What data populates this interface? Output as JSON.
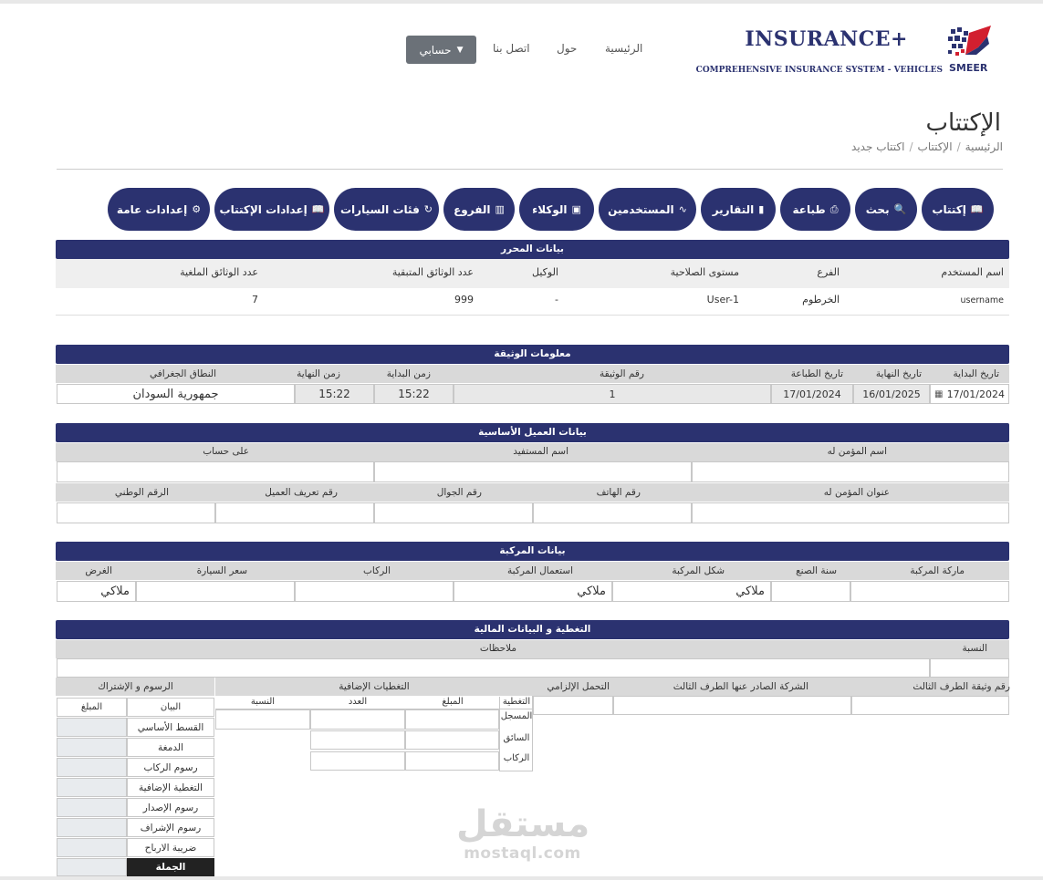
{
  "header": {
    "brand_title": "INSURANCE+",
    "brand_subtitle": "COMPREHENSIVE INSURANCE SYSTEM - VEHICLES",
    "logo_text": "SMEER",
    "nav": [
      "الرئيسية",
      "حول",
      "اتصل بنا"
    ],
    "account_label": "حسابي"
  },
  "page": {
    "title": "الإكتتاب",
    "breadcrumb": [
      "الرئيسية",
      "الإكتتاب",
      "اكتتاب جديد"
    ]
  },
  "toolbar": [
    {
      "label": "إكتتاب",
      "icon": "book-icon"
    },
    {
      "label": "بحث",
      "icon": "search-icon"
    },
    {
      "label": "طباعة",
      "icon": "print-icon"
    },
    {
      "label": "التقارير",
      "icon": "bar-chart-icon"
    },
    {
      "label": "المستخدمين",
      "icon": "pulse-icon"
    },
    {
      "label": "الوكلاء",
      "icon": "id-card-icon"
    },
    {
      "label": "الفروع",
      "icon": "building-icon"
    },
    {
      "label": "فئات السيارات",
      "icon": "refresh-icon"
    },
    {
      "label": "إعدادات الإكتتاب",
      "icon": "book-icon"
    },
    {
      "label": "إعدادات عامة",
      "icon": "gear-icon"
    }
  ],
  "editor": {
    "title": "بيانات المحرر",
    "headers": [
      "اسم المستخدم",
      "الفرع",
      "مستوى الصلاحية",
      "الوكيل",
      "عدد الوثائق المتبقية",
      "عدد الوثائق الملغية"
    ],
    "values": [
      "username",
      "الخرطوم",
      "User-1",
      "-",
      "999",
      "7"
    ]
  },
  "policy": {
    "title": "معلومات الوثيقة",
    "headers": [
      "تاريخ البداية",
      "تاريخ النهاية",
      "تاريخ الطباعة",
      "رقم الوثيقة",
      "زمن البداية",
      "زمن النهاية",
      "النطاق الجغرافي"
    ],
    "values": [
      "17/01/2024",
      "16/01/2025",
      "17/01/2024",
      "1",
      "15:22",
      "15:22",
      "جمهورية السودان"
    ]
  },
  "client": {
    "title": "بيانات العميل الأساسية",
    "row1_labels": [
      "اسم المؤمن له",
      "اسم المستفيد",
      "على حساب"
    ],
    "row2_labels": [
      "عنوان المؤمن له",
      "رقم الهاتف",
      "رقم الجوال",
      "رقم تعريف العميل",
      "الرقم الوطني"
    ]
  },
  "vehicle": {
    "title": "بيانات المركبة",
    "headers": [
      "ماركة المركبة",
      "سنة الصنع",
      "شكل المركبة",
      "استعمال المركبة",
      "الركاب",
      "سعر السيارة",
      "الغرض"
    ],
    "values": [
      "",
      "",
      "ملاكي",
      "ملاكي",
      "",
      "",
      "ملاكي"
    ]
  },
  "coverage": {
    "title": "التغطية و البيانات المالية",
    "ratio_label": "النسبة",
    "notes_label": "ملاحظات",
    "third_party_headers": [
      "رقم وثيقة الطرف الثالث",
      "الشركة الصادر عنها الطرف الثالث",
      "التحمل الإلزامي"
    ],
    "additional_title": "التغطيات الإضافية",
    "additional_cols": [
      "التغطية",
      "المبلغ",
      "العدد",
      "النسبة"
    ],
    "additional_rows": [
      "المسجل",
      "السائق",
      "الركاب"
    ],
    "fees_title": "الرسوم و الإشتراك",
    "fees_cols": [
      "البيان",
      "المبلغ"
    ],
    "fees_rows": [
      "القسط الأساسي",
      "الدمغة",
      "رسوم الركاب",
      "التغطية الإضافية",
      "رسوم الإصدار",
      "رسوم الإشراف",
      "ضريبة الارباح"
    ],
    "total_label": "الجملة"
  },
  "watermark": {
    "ar": "مستقل",
    "en": "mostaql.com"
  }
}
